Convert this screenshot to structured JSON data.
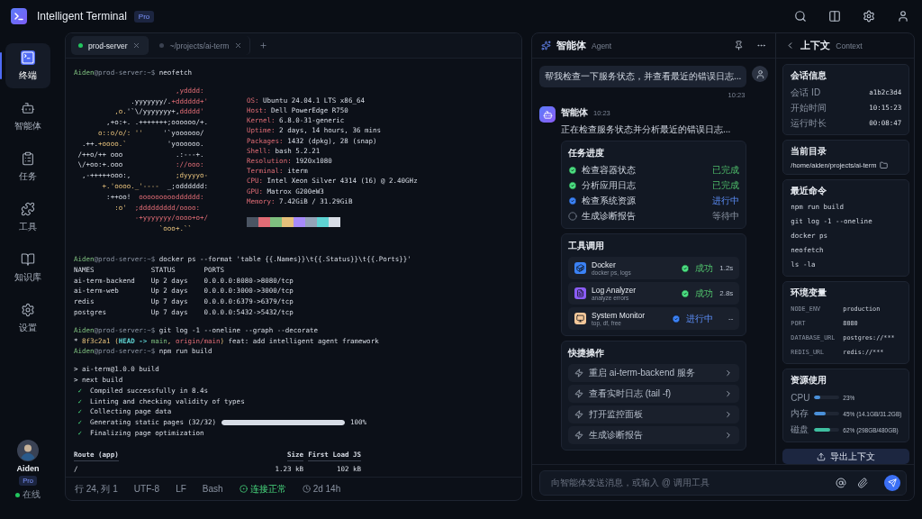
{
  "app": {
    "title": "Intelligent Terminal",
    "badge": "Pro"
  },
  "sidebar": {
    "items": [
      {
        "label": "终端",
        "selected": true
      },
      {
        "label": "智能体",
        "selected": false
      },
      {
        "label": "任务",
        "selected": false
      },
      {
        "label": "工具",
        "selected": false
      },
      {
        "label": "知识库",
        "selected": false
      },
      {
        "label": "设置",
        "selected": false
      }
    ],
    "user": {
      "name": "Aiden",
      "badge": "Pro",
      "status": "在线"
    }
  },
  "terminal": {
    "tabs": [
      {
        "label": "prod-server",
        "selected": true,
        "color": "#22c55e"
      },
      {
        "label": "~/projects/ai-term",
        "selected": false,
        "color": "#3a4150"
      }
    ],
    "lines": [
      {
        "kind": "prompt",
        "user": "Aiden",
        "host": "@prod-server:~$",
        "command": "neofetch"
      },
      {
        "kind": "neofetch",
        "art": [
          [
            {
              "text": "                         ,ydddd:",
              "kind": "accent"
            }
          ],
          [
            {
              "text": "              .yyyyyyy/.",
              "kind": "plain"
            },
            {
              "text": "+dddddd+'",
              "kind": "accent"
            }
          ],
          [
            {
              "text": "          ,o.",
              "kind": "warm"
            },
            {
              "text": "'`\\/yyyyyyy+,",
              "kind": "plain"
            },
            {
              "text": "ddddd'",
              "kind": "accent"
            }
          ],
          [
            {
              "text": "        ,+o:+. .+++++++;oooooo/+.",
              "kind": "plain"
            }
          ],
          [
            {
              "text": "      o::o/o/: ''",
              "kind": "warm"
            },
            {
              "text": "     '`yoooooo/",
              "kind": "plain"
            }
          ],
          [
            {
              "text": "  .++.",
              "kind": "plain"
            },
            {
              "text": "+oooo.`",
              "kind": "warm"
            },
            {
              "text": "          'yoooooo.",
              "kind": "plain"
            }
          ],
          [
            {
              "text": " /++o/++ ooo",
              "kind": "plain"
            },
            {
              "text": "             .:---+.",
              "kind": "plain"
            }
          ],
          [
            {
              "text": " \\/+oo:+.ooo",
              "kind": "plain"
            },
            {
              "text": "             ://ooo:",
              "kind": "accent"
            }
          ],
          [
            {
              "text": "  ,-+++++ooo:,",
              "kind": "plain"
            },
            {
              "text": "           ;dyyyyo-",
              "kind": "warm"
            }
          ],
          [
            {
              "text": "       +.'oooo._'----",
              "kind": "warm"
            },
            {
              "text": "  _;odddddd:",
              "kind": "plain"
            }
          ],
          [
            {
              "text": "        :++oo!",
              "kind": "plain"
            },
            {
              "text": "  ooooooooodddddd:",
              "kind": "accent"
            }
          ],
          [
            {
              "text": "          :o'",
              "kind": "warm"
            },
            {
              "text": "  ;ddddddddd/oooo:",
              "kind": "accent"
            }
          ],
          [
            {
              "text": "               -+yyyyyyy/oooo+o+/",
              "kind": "accent"
            }
          ],
          [
            {
              "text": "                     `ooo+.``",
              "kind": "warm"
            }
          ]
        ],
        "info": [
          {
            "key": "OS:",
            "value": "Ubuntu 24.04.1 LTS x86_64"
          },
          {
            "key": "Host:",
            "value": "Dell PowerEdge R750"
          },
          {
            "key": "Kernel:",
            "value": "6.8.0-31-generic"
          },
          {
            "key": "Uptime:",
            "value": "2 days, 14 hours, 36 mins"
          },
          {
            "key": "Packages:",
            "value": "1432 (dpkg), 28 (snap)"
          },
          {
            "key": "Shell:",
            "value": "bash 5.2.21"
          },
          {
            "key": "Resolution:",
            "value": "1920x1080"
          },
          {
            "key": "Terminal:",
            "value": "iterm"
          },
          {
            "key": "CPU:",
            "value": "Intel Xeon Silver 4314 (16) @ 2.40GHz"
          },
          {
            "key": "GPU:",
            "value": "Matrox G200eW3"
          },
          {
            "key": "Memory:",
            "value": "7.42GiB / 31.29GiB"
          }
        ],
        "palette": [
          {
            "color": "#4b5563"
          },
          {
            "color": "#e06c75"
          },
          {
            "color": "#7fbf7f"
          },
          {
            "color": "#e5c07b"
          },
          {
            "color": "#a78bfa"
          },
          {
            "color": "#94a3b8"
          },
          {
            "color": "#5fd3d3"
          },
          {
            "color": "#d8dde6"
          }
        ]
      },
      {
        "kind": "prompt",
        "user": "Aiden",
        "host": "@prod-server:~$",
        "command": "docker ps --format 'table {{.Names}}\\t{{.Status}}\\t{{.Ports}}'"
      },
      {
        "kind": "plain",
        "text": "NAMES              STATUS       PORTS"
      },
      {
        "kind": "plain",
        "text": "ai-term-backend    Up 2 days    0.0.0.0:8080->8080/tcp"
      },
      {
        "kind": "plain",
        "text": "ai-term-web        Up 2 days    0.0.0.0:3000->3000/tcp"
      },
      {
        "kind": "plain",
        "text": "redis              Up 7 days    0.0.0.0:6379->6379/tcp"
      },
      {
        "kind": "plain",
        "text": "postgres           Up 7 days    0.0.0.0:5432->5432/tcp"
      },
      {
        "kind": "blank"
      },
      {
        "kind": "prompt",
        "user": "Aiden",
        "host": "@prod-server:~$",
        "command": "git log -1 --oneline --graph --decorate"
      },
      {
        "kind": "segments",
        "segments": [
          {
            "text": "* ",
            "kind": "plain"
          },
          {
            "text": "8f3c2a1",
            "kind": "warm"
          },
          {
            "text": " (",
            "kind": "warm"
          },
          {
            "text": "HEAD -> ",
            "kind": "ref"
          },
          {
            "text": "main",
            "kind": "branch"
          },
          {
            "text": ", ",
            "kind": "warm"
          },
          {
            "text": "origin/main",
            "kind": "accent"
          },
          {
            "text": ")",
            "kind": "warm"
          },
          {
            "text": " feat: add intelligent agent framework",
            "kind": "plain"
          }
        ]
      },
      {
        "kind": "prompt",
        "user": "Aiden",
        "host": "@prod-server:~$",
        "command": "npm run build"
      },
      {
        "kind": "blank"
      },
      {
        "kind": "plain",
        "text": "> ai-term@1.0.0 build"
      },
      {
        "kind": "plain",
        "text": "> next build"
      },
      {
        "kind": "check",
        "mark": "✓",
        "text": "Compiled successfully in 8.4s"
      },
      {
        "kind": "check",
        "mark": "✓",
        "text": "Linting and checking validity of types"
      },
      {
        "kind": "check",
        "mark": "✓",
        "text": "Collecting page data"
      },
      {
        "kind": "progress",
        "mark": "✓",
        "text": "Generating static pages (32/32)",
        "level": 1,
        "reading": "100%"
      },
      {
        "kind": "check",
        "mark": "✓",
        "text": "Finalizing page optimization"
      },
      {
        "kind": "blank"
      },
      {
        "kind": "route_header",
        "cells": [
          "Route (app)",
          "Size",
          "First Load JS"
        ]
      },
      {
        "kind": "route_row",
        "cells": [
          "/",
          "1.23 kB",
          "102 kB"
        ]
      }
    ]
  },
  "status_bar": {
    "items": [
      "行 24, 列 1",
      "UTF-8",
      "LF",
      "Bash"
    ],
    "connection": "连接正常",
    "uptime": "2d 14h"
  },
  "agent": {
    "title": "智能体",
    "subtitle": "Agent",
    "user_message": {
      "text": "帮我检查一下服务状态，并查看最近的错误日志...",
      "time": "10:23"
    },
    "reply": {
      "name": "智能体",
      "time": "10:23",
      "text": "正在检查服务状态并分析最近的错误日志...",
      "tasks": {
        "title": "任务进度",
        "items": [
          {
            "label": "检查容器状态",
            "status": "已完成",
            "kind": "done"
          },
          {
            "label": "分析应用日志",
            "status": "已完成",
            "kind": "done"
          },
          {
            "label": "检查系统资源",
            "status": "进行中",
            "kind": "active"
          },
          {
            "label": "生成诊断报告",
            "status": "等待中",
            "kind": "pending"
          }
        ]
      },
      "tools": {
        "title": "工具调用",
        "items": [
          {
            "name": "Docker",
            "detail": "docker ps, logs",
            "status": "成功",
            "duration": "1.2s",
            "kind": "done",
            "color": "#3b82f6"
          },
          {
            "name": "Log Analyzer",
            "detail": "analyze errors",
            "status": "成功",
            "duration": "2.8s",
            "kind": "done",
            "color": "#8b5cf6"
          },
          {
            "name": "System Monitor",
            "detail": "top, df, free",
            "status": "进行中",
            "duration": "--",
            "kind": "active",
            "color": "#f5c89a"
          }
        ]
      },
      "actions": {
        "title": "快捷操作",
        "items": [
          "重启 ai-term-backend 服务",
          "查看实时日志 (tail -f)",
          "打开监控面板",
          "生成诊断报告"
        ]
      }
    },
    "input": {
      "placeholder": "向智能体发送消息，或输入 @ 调用工具"
    }
  },
  "context": {
    "title": "上下文",
    "subtitle": "Context",
    "session": {
      "title": "会话信息",
      "rows": [
        {
          "key": "会话 ID",
          "value": "a1b2c3d4"
        },
        {
          "key": "开始时间",
          "value": "10:15:23"
        },
        {
          "key": "运行时长",
          "value": "00:08:47"
        }
      ]
    },
    "directory": {
      "title": "当前目录",
      "path": "/home/aiden/projects/ai-term"
    },
    "commands": {
      "title": "最近命令",
      "items": [
        "npm run build",
        "git log -1 --oneline",
        "docker ps",
        "neofetch",
        "ls -la"
      ]
    },
    "env": {
      "title": "环境变量",
      "rows": [
        {
          "key": "NODE_ENV",
          "value": "production"
        },
        {
          "key": "PORT",
          "value": "8080"
        },
        {
          "key": "DATABASE_URL",
          "value": "postgres://***"
        },
        {
          "key": "REDIS_URL",
          "value": "redis://***"
        }
      ]
    },
    "resources": {
      "title": "资源使用",
      "items": [
        {
          "label": "CPU",
          "level": 0.23,
          "reading": "23%",
          "color": "#4a90d9"
        },
        {
          "label": "内存",
          "level": 0.45,
          "reading": "45% (14.1GB/31.2GB)",
          "color": "#4a90d9"
        },
        {
          "label": "磁盘",
          "level": 0.62,
          "reading": "62% (298GB/480GB)",
          "color": "#3fbfa0"
        }
      ]
    },
    "export_button": "导出上下文"
  }
}
